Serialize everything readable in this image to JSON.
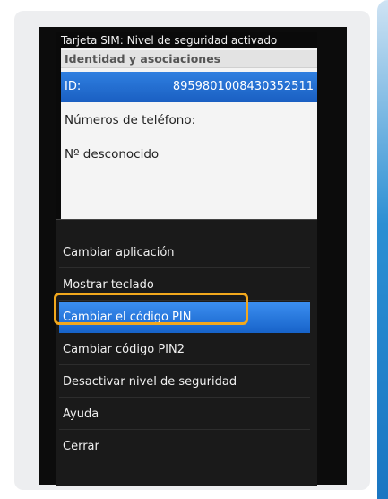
{
  "status_bar": {
    "text": "Tarjeta SIM: Nivel de seguridad activado"
  },
  "panel": {
    "section_header": "Identidad y asociaciones",
    "id_label": "ID:",
    "id_value": "8959801008430352511",
    "phone_numbers_label": "Números de teléfono:",
    "phone_number_value": "Nº desconocido"
  },
  "menu": {
    "items": [
      {
        "label": "Cambiar aplicación",
        "selected": false
      },
      {
        "label": "Mostrar teclado",
        "selected": false
      },
      {
        "label": "Cambiar el código PIN",
        "selected": true
      },
      {
        "label": "Cambiar código PIN2",
        "selected": false
      },
      {
        "label": "Desactivar nivel de seguridad",
        "selected": false
      },
      {
        "label": "Ayuda",
        "selected": false
      },
      {
        "label": "Cerrar",
        "selected": false
      }
    ]
  },
  "colors": {
    "selection_blue": "#1a5fc2",
    "highlight_orange": "#f2a81d",
    "menu_background": "#1a1a1a"
  }
}
